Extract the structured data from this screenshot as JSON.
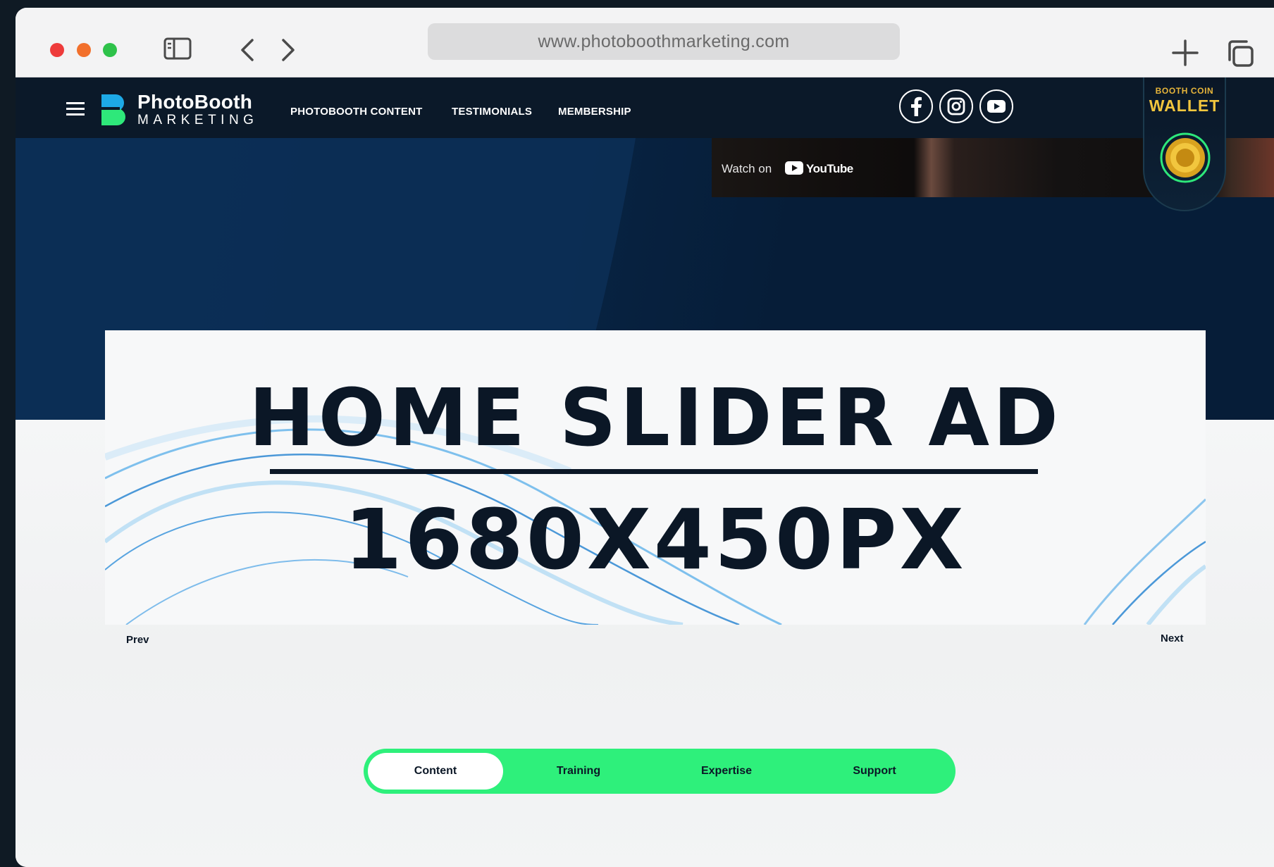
{
  "browser": {
    "url": "www.photoboothmarketing.com"
  },
  "header": {
    "logo_line1": "PhotoBooth",
    "logo_line2": "MARKETING",
    "nav": [
      "PHOTOBOOTH CONTENT",
      "TESTIMONIALS",
      "MEMBERSHIP"
    ],
    "social_icons": [
      "facebook-icon",
      "instagram-icon",
      "youtube-icon"
    ],
    "wallet": {
      "top_label": "BOOTH COIN",
      "title": "WALLET"
    }
  },
  "video": {
    "watch_label": "Watch on",
    "platform": "YouTube"
  },
  "slider": {
    "headline": "HOME SLIDER AD",
    "dimensions": "1680X450PX",
    "prev_label": "Prev",
    "next_label": "Next"
  },
  "tabs": [
    "Content",
    "Training",
    "Expertise",
    "Support"
  ],
  "active_tab": "Content",
  "colors": {
    "header_bg": "#0b1929",
    "accent_green": "#2ef07b",
    "wallet_gold": "#f2c63e",
    "text_dark": "#0b1726"
  }
}
